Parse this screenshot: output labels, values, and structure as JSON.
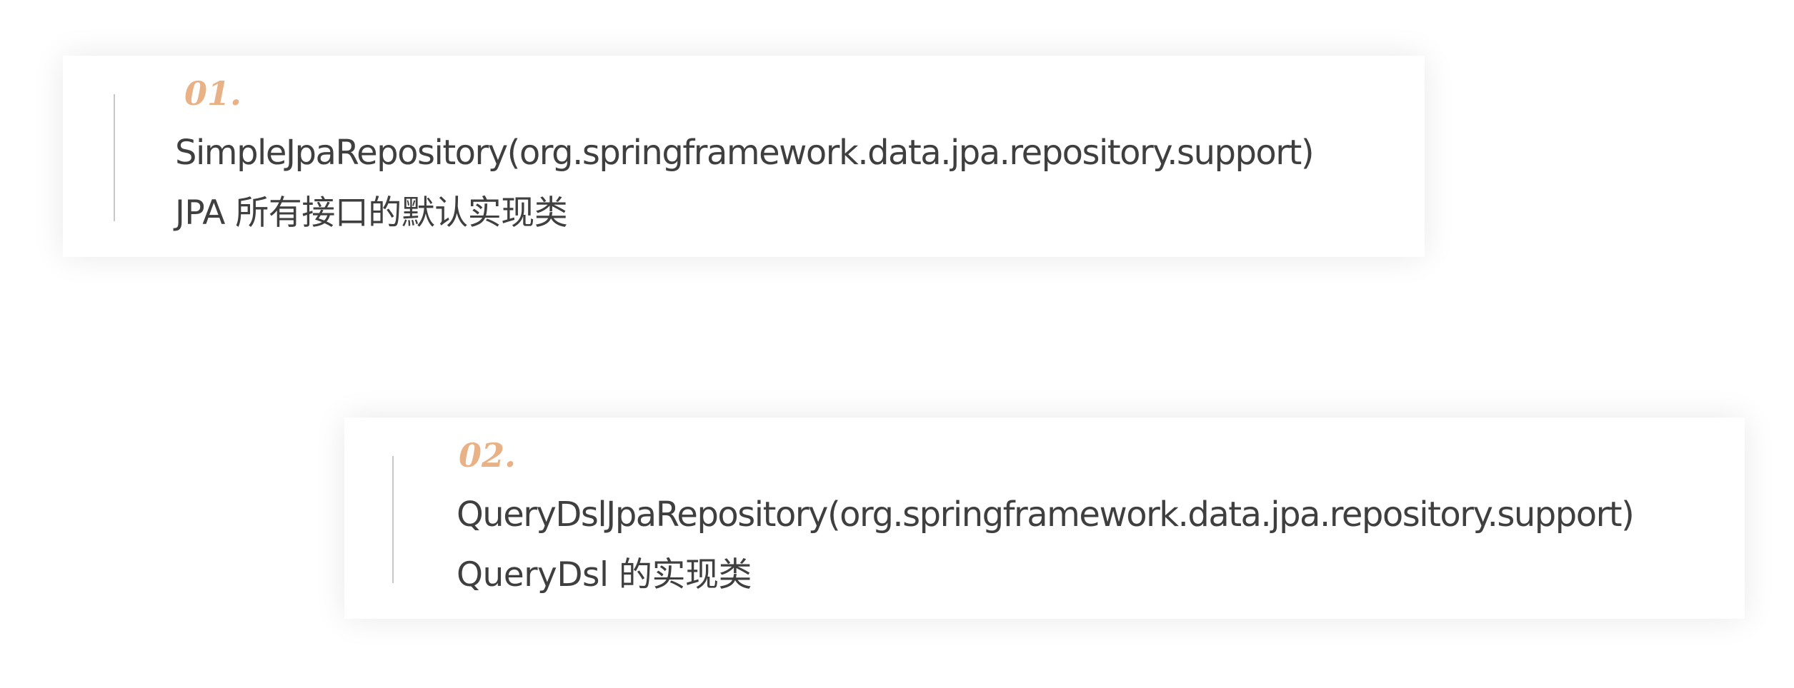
{
  "items": [
    {
      "number": "01.",
      "title": "SimpleJpaRepository(org.springframework.data.jpa.repository.support)",
      "description": "JPA 所有接口的默认实现类"
    },
    {
      "number": "02.",
      "title": "QueryDslJpaRepository(org.springframework.data.jpa.repository.support)",
      "description": "QueryDsl 的实现类"
    }
  ],
  "colors": {
    "number_accent": "#e8b186",
    "text": "#3f3f3f",
    "divider": "#c7c7c7",
    "background": "#ffffff"
  }
}
